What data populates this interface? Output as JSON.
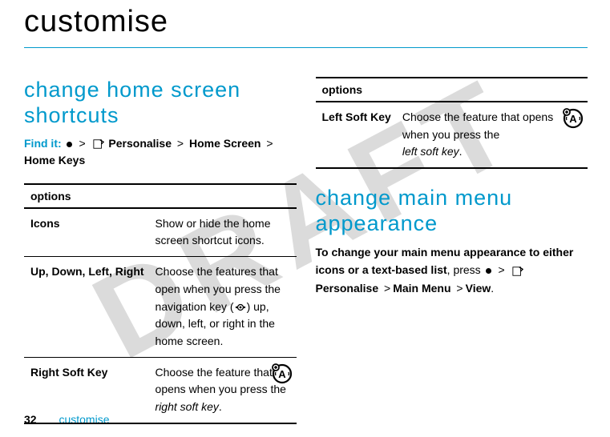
{
  "watermark": "DRAFT",
  "title": "customise",
  "left": {
    "heading": "change home screen shortcuts",
    "findit_label": "Find it:",
    "path": [
      "Personalise",
      "Home Screen",
      "Home Keys"
    ],
    "table_header": "options",
    "rows": [
      {
        "label": "Icons",
        "desc": "Show or hide the home screen shortcut icons."
      },
      {
        "label": "Up, Down, Left, Right",
        "desc_pre": "Choose the features that open when you press the navigation key (",
        "desc_post": ") up, down, left, or right in the home screen."
      },
      {
        "label": "Right Soft Key",
        "desc_line1": "Choose the feature that opens when you press the",
        "desc_line2": "right soft key",
        "desc_line3": ".",
        "badge": true
      }
    ]
  },
  "right": {
    "table_header": "options",
    "rows": [
      {
        "label": "Left Soft Key",
        "desc_line1": "Choose the feature that opens when you press the",
        "desc_line2": "left soft key",
        "desc_line3": ".",
        "badge": true
      }
    ],
    "heading": "change main menu appearance",
    "para_bold": "To change your main menu appearance to either icons or a text-based list",
    "para_mid": ", press ",
    "path": [
      "Personalise",
      "Main Menu",
      "View"
    ],
    "para_end": "."
  },
  "footer": {
    "page": "32",
    "section": "customise"
  }
}
